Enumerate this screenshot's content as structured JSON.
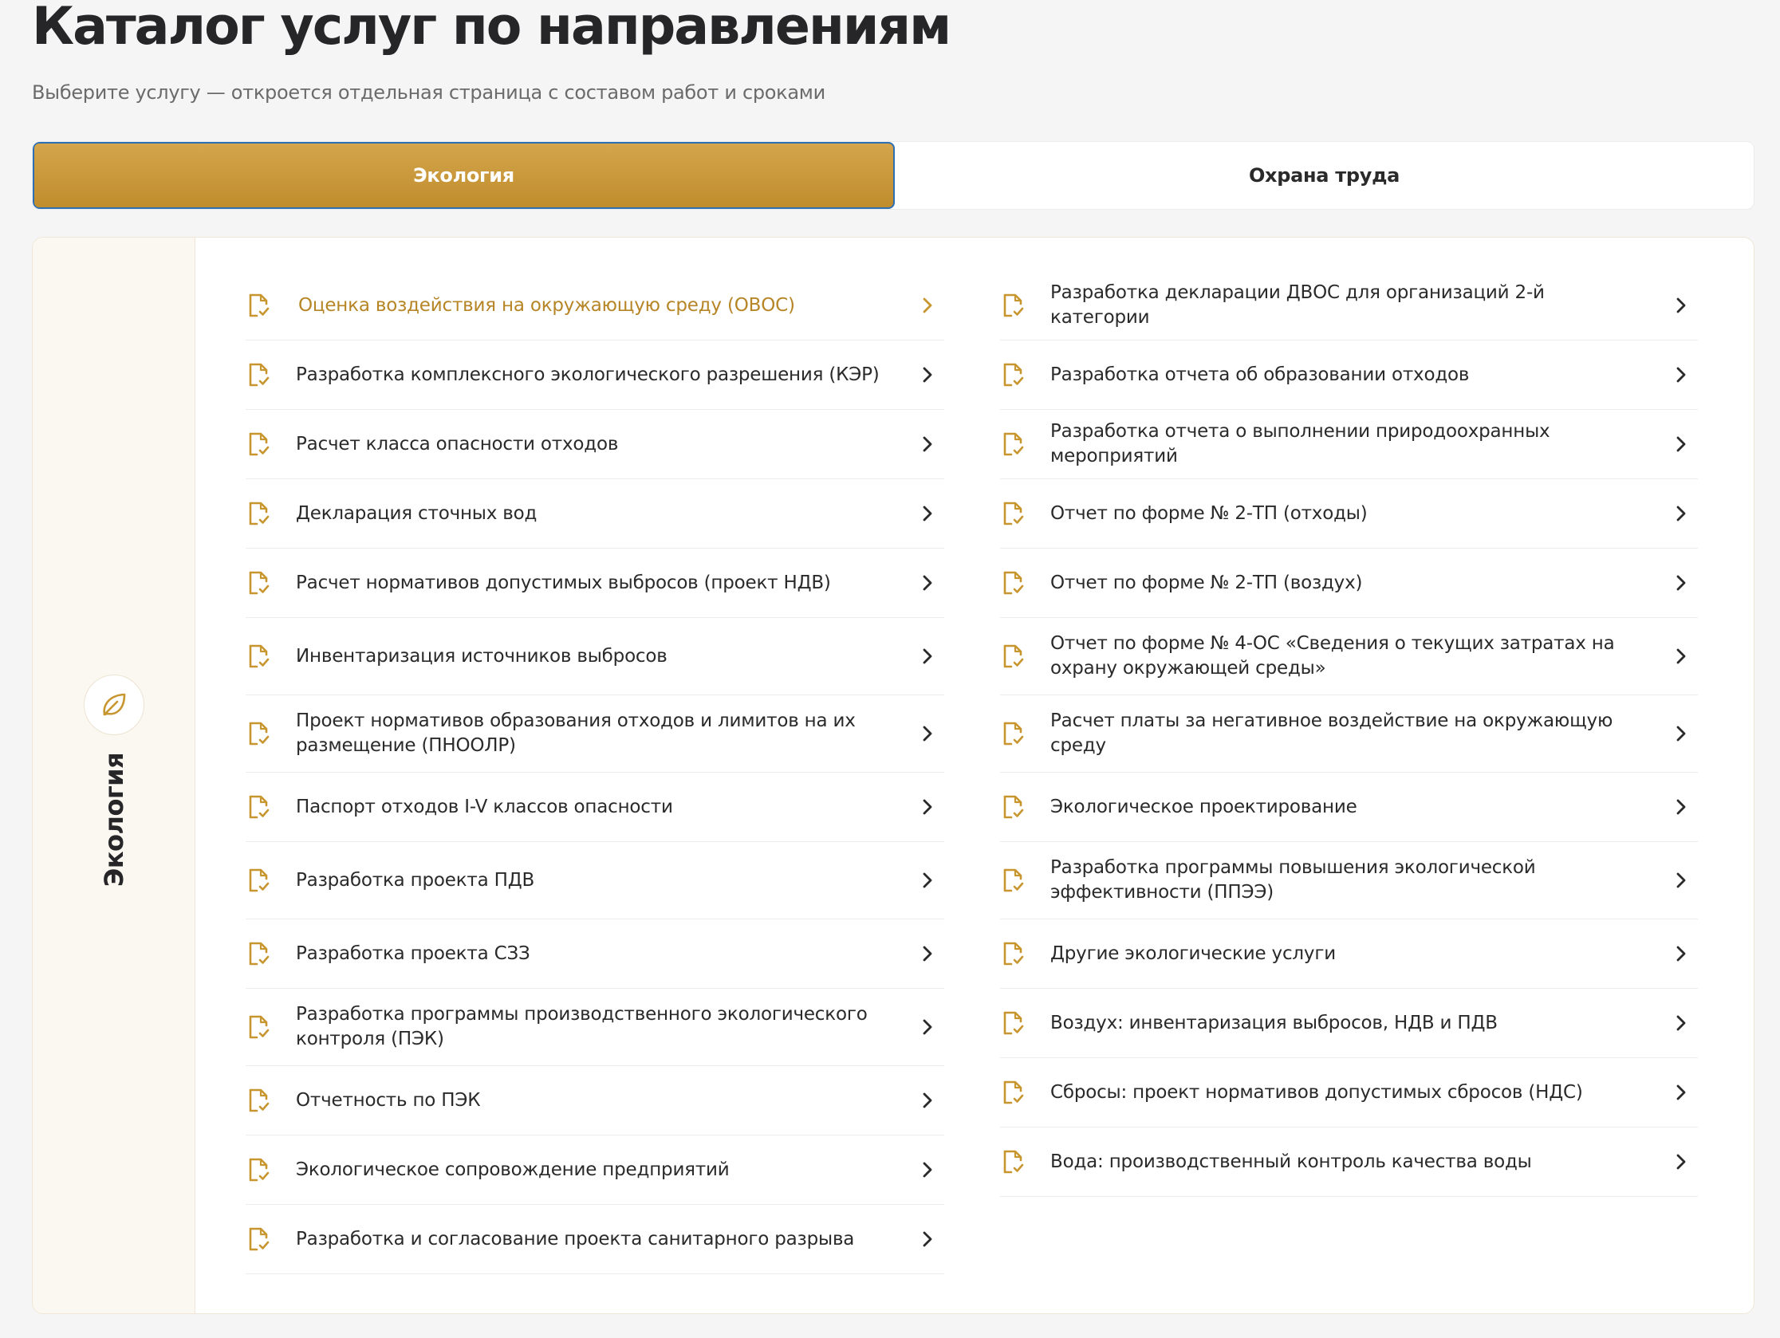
{
  "page": {
    "title": "Каталог услуг по направлениям",
    "subtitle": "Выберите услугу — откроется отдельная страница с составом работ и сроками"
  },
  "tabs": [
    {
      "label": "Экология",
      "active": true
    },
    {
      "label": "Охрана труда",
      "active": false
    }
  ],
  "sidebar": {
    "label": "Экология",
    "icon": "leaf-icon"
  },
  "colors": {
    "accent": "#c8962f",
    "accent_text": "#b68526",
    "text": "#2a2a2a"
  },
  "services_left": [
    {
      "label": "Оценка воздействия на окружающую среду (ОВОС)"
    },
    {
      "label": "Разработка комплексного экологического разрешения (КЭР)"
    },
    {
      "label": "Расчет класса опасности отходов"
    },
    {
      "label": "Декларация сточных вод"
    },
    {
      "label": "Расчет нормативов допустимых выбросов (проект НДВ)"
    },
    {
      "label": "Инвентаризация источников выбросов"
    },
    {
      "label": "Проект нормативов образования отходов и лимитов на их размещение (ПНООЛР)"
    },
    {
      "label": "Паспорт отходов I-V классов опасности"
    },
    {
      "label": "Разработка проекта ПДВ"
    },
    {
      "label": "Разработка проекта СЗЗ"
    },
    {
      "label": "Разработка программы производственного экологического контроля (ПЭК)"
    },
    {
      "label": "Отчетность по ПЭК"
    },
    {
      "label": "Экологическое сопровождение предприятий"
    },
    {
      "label": "Разработка и согласование проекта санитарного разрыва"
    }
  ],
  "services_right": [
    {
      "label": "Разработка декларации ДВОС для организаций 2-й категории"
    },
    {
      "label": "Разработка отчета об образовании отходов"
    },
    {
      "label": "Разработка отчета о выполнении природоохранных мероприятий"
    },
    {
      "label": "Отчет по форме № 2-ТП (отходы)"
    },
    {
      "label": "Отчет по форме № 2-ТП (воздух)"
    },
    {
      "label": "Отчет по форме № 4-ОС «Сведения о текущих затратах на охрану окружающей среды»"
    },
    {
      "label": "Расчет платы за негативное воздействие на окружающую среду"
    },
    {
      "label": "Экологическое проектирование"
    },
    {
      "label": "Разработка программы повышения экологической эффективности (ППЭЭ)"
    },
    {
      "label": "Другие экологические услуги"
    },
    {
      "label": "Воздух: инвентаризация выбросов, НДВ и ПДВ"
    },
    {
      "label": "Сбросы: проект нормативов допустимых сбросов (НДС)"
    },
    {
      "label": "Вода: производственный контроль качества воды"
    }
  ]
}
